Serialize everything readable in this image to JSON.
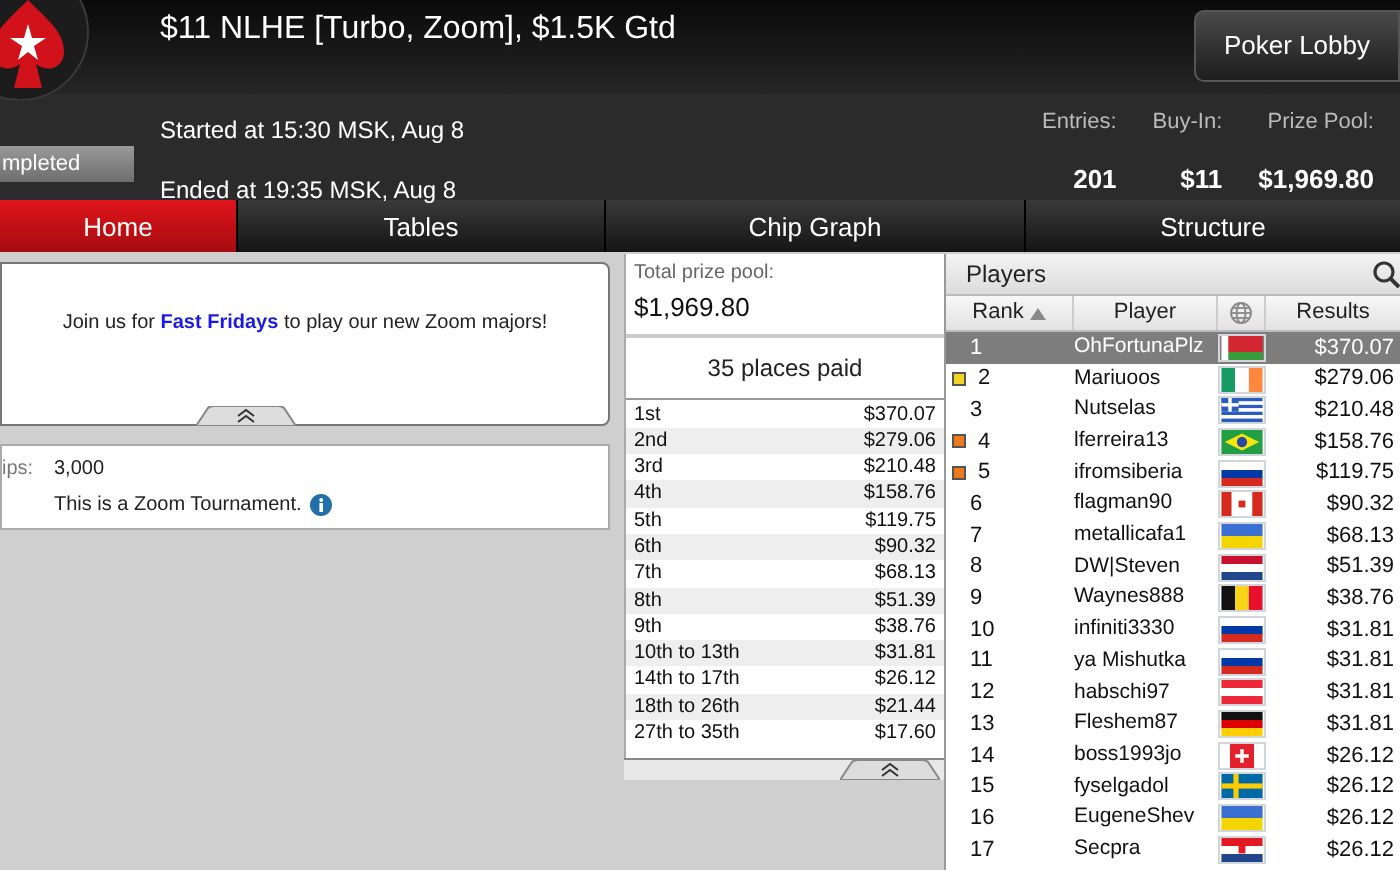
{
  "header": {
    "title": "$11 NLHE [Turbo, Zoom], $1.5K Gtd",
    "started": "Started at 15:30 MSK, Aug 8",
    "ended": "Ended at 19:35 MSK, Aug 8",
    "status": "mpleted",
    "lobby_button": "Poker Lobby",
    "stats": [
      {
        "label": "Entries:",
        "value": "201"
      },
      {
        "label": "Buy-In:",
        "value": "$11"
      },
      {
        "label": "Prize Pool:",
        "value": "$1,969.80"
      }
    ]
  },
  "tabs": [
    {
      "label": "Home",
      "selected": true
    },
    {
      "label": "Tables",
      "selected": false
    },
    {
      "label": "Chip Graph",
      "selected": false
    },
    {
      "label": "Structure",
      "selected": false
    }
  ],
  "banner": {
    "text": "Join us for **Fast Fridays** to play our new Zoom majors!"
  },
  "info": {
    "chips_label": "ips:",
    "chips_value": "3,000",
    "note": "This is a Zoom Tournament."
  },
  "prizes": {
    "total_label": "Total prize pool:",
    "total_value": "$1,969.80",
    "places_paid": "35 places paid",
    "rows": [
      {
        "place": "1st",
        "amount": "$370.07"
      },
      {
        "place": "2nd",
        "amount": "$279.06"
      },
      {
        "place": "3rd",
        "amount": "$210.48"
      },
      {
        "place": "4th",
        "amount": "$158.76"
      },
      {
        "place": "5th",
        "amount": "$119.75"
      },
      {
        "place": "6th",
        "amount": "$90.32"
      },
      {
        "place": "7th",
        "amount": "$68.13"
      },
      {
        "place": "8th",
        "amount": "$51.39"
      },
      {
        "place": "9th",
        "amount": "$38.76"
      },
      {
        "place": "10th to 13th",
        "amount": "$31.81"
      },
      {
        "place": "14th to 17th",
        "amount": "$26.12"
      },
      {
        "place": "18th to 26th",
        "amount": "$21.44"
      },
      {
        "place": "27th to 35th",
        "amount": "$17.60"
      }
    ]
  },
  "players": {
    "title": "Players",
    "columns": [
      "Rank",
      "Player",
      "Results"
    ],
    "rows": [
      {
        "rank": "1",
        "name": "OhFortunaPlz",
        "kind": "belarus",
        "result": "$370.07",
        "selected": true
      },
      {
        "rank": "2",
        "name": "Mariuoos",
        "kind": "ireland",
        "result": "$279.06",
        "selected": false,
        "color": "#f2d422"
      },
      {
        "rank": "3",
        "name": "Nutselas",
        "kind": "greece",
        "result": "$210.48",
        "selected": false
      },
      {
        "rank": "4",
        "name": "lferreira13",
        "kind": "brazil",
        "result": "$158.76",
        "selected": false,
        "color": "#ee7a1c"
      },
      {
        "rank": "5",
        "name": "ifromsiberia",
        "kind": "russia",
        "result": "$119.75",
        "selected": false,
        "color": "#ee7a1c"
      },
      {
        "rank": "6",
        "name": "flagman90",
        "kind": "canada",
        "result": "$90.32",
        "selected": false
      },
      {
        "rank": "7",
        "name": "metallicafa1",
        "kind": "ukraine",
        "result": "$68.13",
        "selected": false
      },
      {
        "rank": "8",
        "name": "DW|Steven",
        "kind": "netherlands",
        "result": "$51.39",
        "selected": false
      },
      {
        "rank": "9",
        "name": "Waynes888",
        "kind": "belgium",
        "result": "$38.76",
        "selected": false
      },
      {
        "rank": "10",
        "name": "infiniti3330",
        "kind": "russia",
        "result": "$31.81",
        "selected": false
      },
      {
        "rank": "11",
        "name": "ya Mishutka",
        "kind": "russia",
        "result": "$31.81",
        "selected": false
      },
      {
        "rank": "12",
        "name": "habschi97",
        "kind": "austria",
        "result": "$31.81",
        "selected": false
      },
      {
        "rank": "13",
        "name": "Fleshem87",
        "kind": "germany",
        "result": "$31.81",
        "selected": false
      },
      {
        "rank": "14",
        "name": "boss1993jo",
        "kind": "switzerland",
        "result": "$26.12",
        "selected": false
      },
      {
        "rank": "15",
        "name": "fyselgadol",
        "kind": "sweden",
        "result": "$26.12",
        "selected": false
      },
      {
        "rank": "16",
        "name": "EugeneShev",
        "kind": "ukraine",
        "result": "$26.12",
        "selected": false
      },
      {
        "rank": "17",
        "name": "Secpra",
        "kind": "croatia",
        "result": "$26.12",
        "selected": false
      }
    ]
  }
}
